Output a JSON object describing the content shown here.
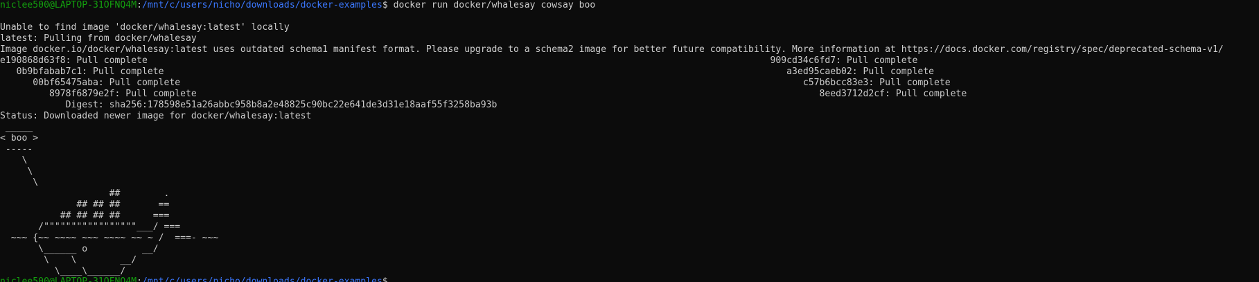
{
  "prompt": {
    "user_host": "niclee500@LAPTOP-31OFNQ4M",
    "separator": ":",
    "path": "/mnt/c/users/nicho/downloads/docker-examples",
    "symbol": "$ ",
    "command": "docker run docker/whalesay cowsay boo"
  },
  "output": [
    "",
    "Unable to find image 'docker/whalesay:latest' locally",
    "latest: Pulling from docker/whalesay",
    "Image docker.io/docker/whalesay:latest uses outdated schema1 manifest format. Please upgrade to a schema2 image for better future compatibility. More information at https://docs.docker.com/registry/spec/deprecated-schema-v1/",
    "e190868d63f8: Pull complete                                                                                                                  909cd34c6fd7: Pull complete",
    "   0b9bfabab7c1: Pull complete                                                                                                                  a3ed95caeb02: Pull complete",
    "      00bf65475aba: Pull complete                                                                                                                  c57b6bcc83e3: Pull complete",
    "         8978f6879e2f: Pull complete                                                                                                                  8eed3712d2cf: Pull complete",
    "            Digest: sha256:178598e51a26abbc958b8a2e48825c90bc22e641de3d31e18aaf55f3258ba93b",
    "Status: Downloaded newer image for docker/whalesay:latest",
    " _____",
    "< boo >",
    " -----",
    "    \\",
    "     \\",
    "      \\",
    "                    ##        .",
    "              ## ## ##       ==",
    "           ## ## ## ##      ===",
    "       /\"\"\"\"\"\"\"\"\"\"\"\"\"\"\"\"\"___/ ===",
    "  ~~~ {~~ ~~~~ ~~~ ~~~~ ~~ ~ /  ===- ~~~",
    "       \\______ o          __/",
    "        \\    \\        __/",
    "          \\____\\______/"
  ],
  "next_prompt": {
    "user_host": "niclee500@LAPTOP-31OFNQ4M",
    "separator": ":",
    "path": "/mnt/c/users/nicho/downloads/docker-examples",
    "symbol": "$"
  }
}
